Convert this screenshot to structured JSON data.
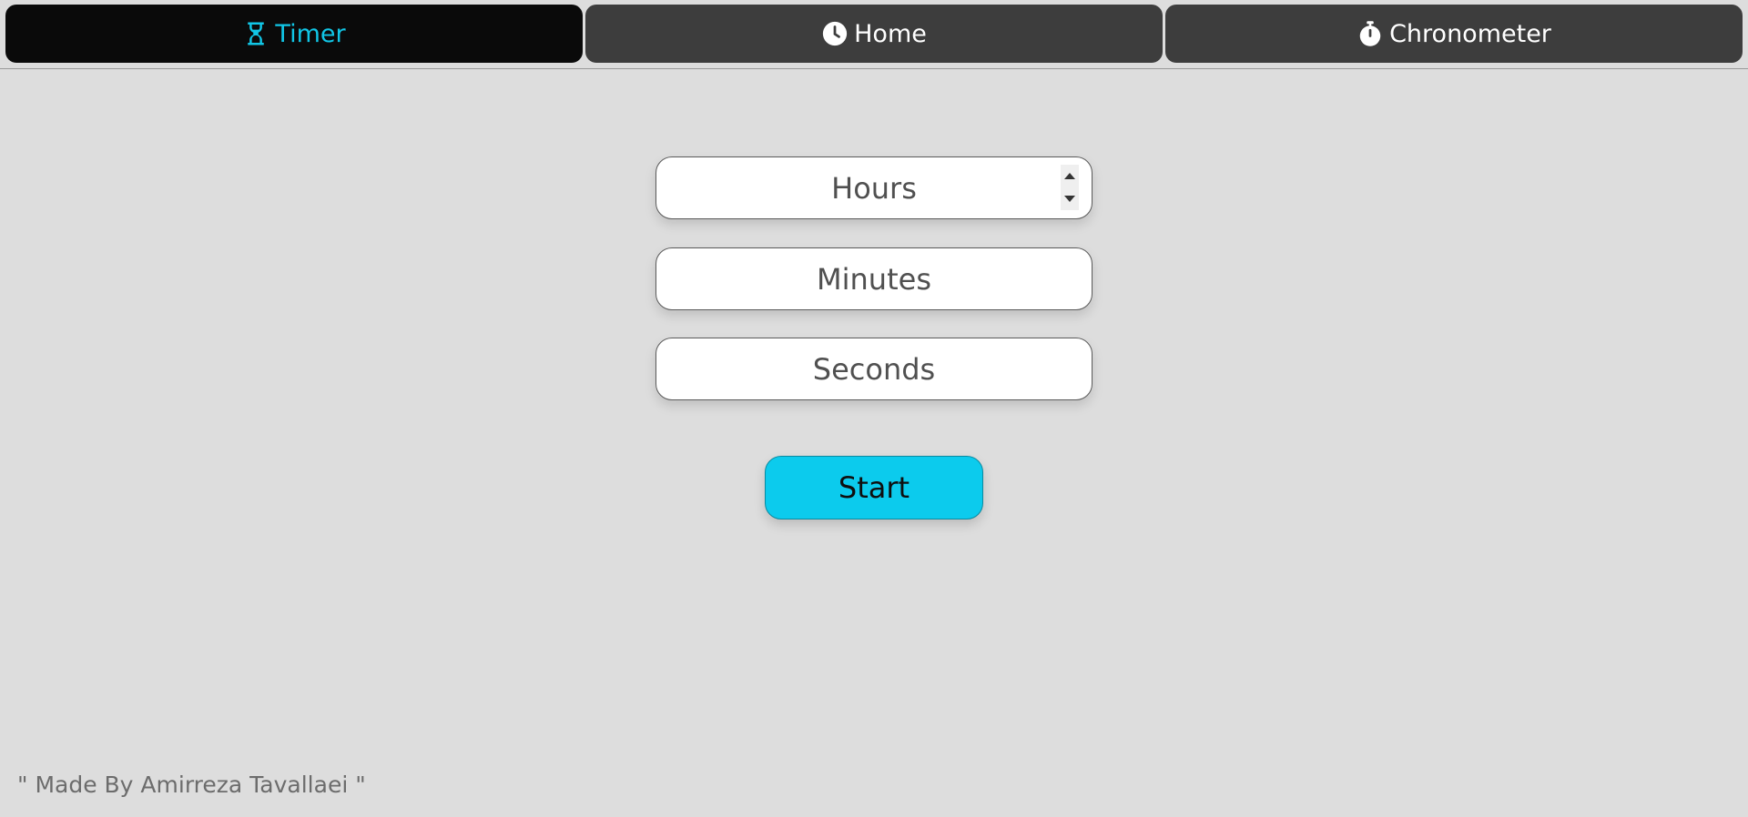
{
  "nav": {
    "tabs": [
      {
        "label": "Timer",
        "icon": "hourglass-icon",
        "active": true
      },
      {
        "label": "Home",
        "icon": "clock-icon",
        "active": false
      },
      {
        "label": "Chronometer",
        "icon": "stopwatch-icon",
        "active": false
      }
    ]
  },
  "form": {
    "hours": {
      "placeholder": "Hours",
      "value": ""
    },
    "minutes": {
      "placeholder": "Minutes",
      "value": ""
    },
    "seconds": {
      "placeholder": "Seconds",
      "value": ""
    },
    "start_label": "Start"
  },
  "footer": {
    "text": "\" Made By Amirreza Tavallaei \""
  },
  "colors": {
    "accent": "#0ccbed",
    "nav_active_bg": "#0a0a0a",
    "nav_bg": "#3d3d3d",
    "page_bg": "#dddddd"
  }
}
